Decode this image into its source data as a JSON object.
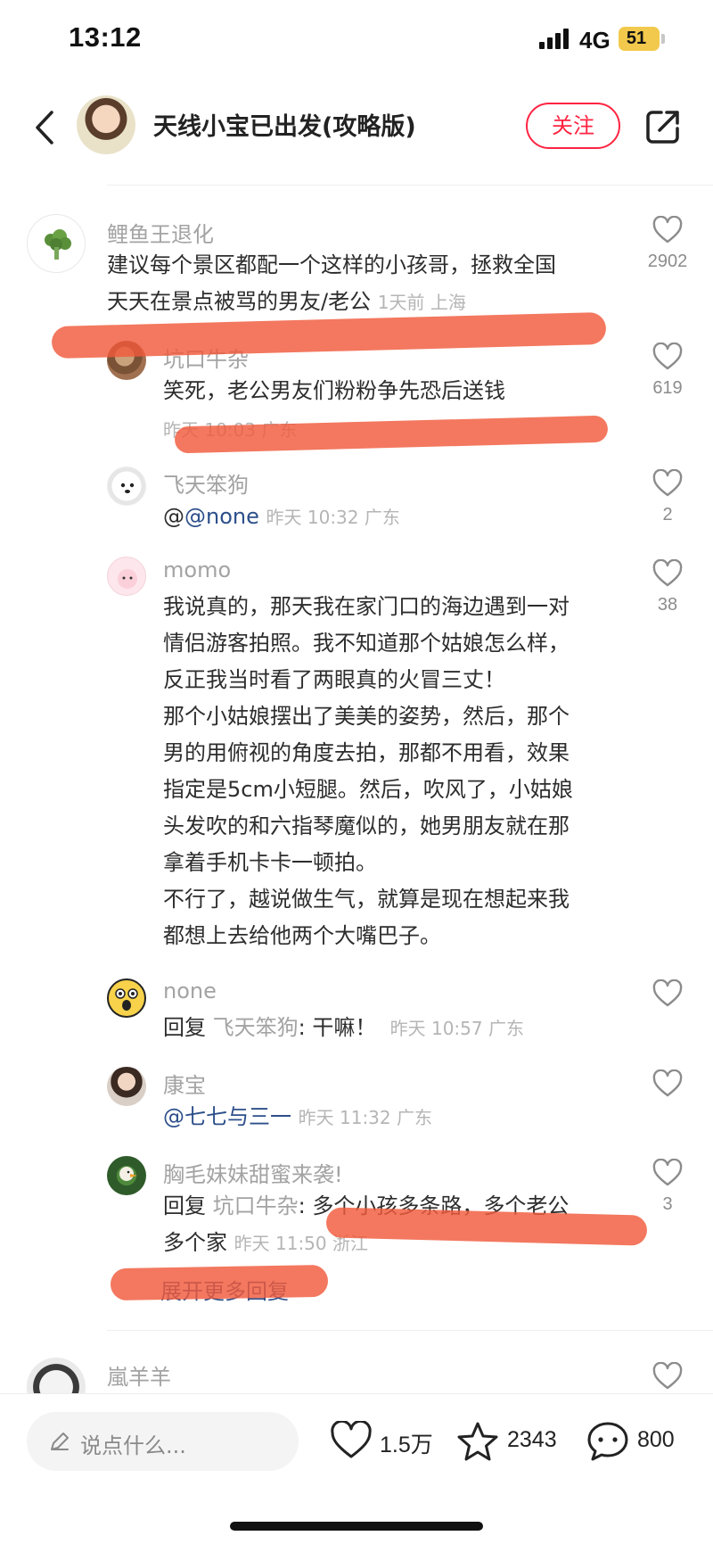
{
  "status_bar": {
    "time": "13:12",
    "network": "4G",
    "battery": "51"
  },
  "header": {
    "title": "天线小宝已出发(攻略版)",
    "follow_label": "关注"
  },
  "comments": [
    {
      "username": "鲤鱼王退化",
      "lines": [
        "建议每个景区都配一个这样的小孩哥，拯救全国",
        "天天在景点被骂的男友/老公"
      ],
      "meta": "1天前 上海",
      "likes": "2902"
    },
    {
      "username": "坑口牛杂",
      "lines": [
        "笑死，老公男友们粉粉争先恐后送钱"
      ],
      "meta": "昨天 10:03 广东",
      "likes": "619"
    },
    {
      "username": "飞天笨狗",
      "prefix": "@",
      "mention": "@none",
      "meta": "昨天 10:32 广东",
      "likes": "2"
    },
    {
      "username": "momo",
      "lines": [
        "我说真的，那天我在家门口的海边遇到一对",
        "情侣游客拍照。我不知道那个姑娘怎么样，",
        "反正我当时看了两眼真的火冒三丈！",
        "那个小姑娘摆出了美美的姿势，然后，那个",
        "男的用俯视的角度去拍，那都不用看，效果",
        "指定是5cm小短腿。然后，吹风了，小姑娘",
        "头发吹的和六指琴魔似的，她男朋友就在那",
        "拿着手机卡卡一顿拍。",
        "不行了，越说做生气，就算是现在想起来我",
        "都想上去给他两个大嘴巴子。"
      ],
      "likes": "38"
    },
    {
      "username": "none",
      "reply_word": "回复",
      "reply_to": "飞天笨狗",
      "text": ": 干嘛！",
      "meta": "昨天 10:57 广东"
    },
    {
      "username": "康宝",
      "mention": "@七七与三一",
      "meta": "昨天 11:32 广东"
    },
    {
      "username": "胸毛妹妹甜蜜来袭!",
      "reply_word": "回复",
      "reply_to": "坑口牛杂",
      "text": ": 多个小孩多条路，多个老公",
      "text2": "多个家",
      "meta": "昨天 11:50 浙江",
      "likes": "3"
    },
    {
      "username": "嵐羊羊"
    }
  ],
  "expand_label": "展开更多回复",
  "bottom_bar": {
    "input_placeholder": "说点什么...",
    "likes": "1.5万",
    "favorites": "2343",
    "comments": "800"
  },
  "colors": {
    "accent": "#ff2442",
    "marker": "#f05a3c",
    "mention": "#2d4f8a"
  }
}
